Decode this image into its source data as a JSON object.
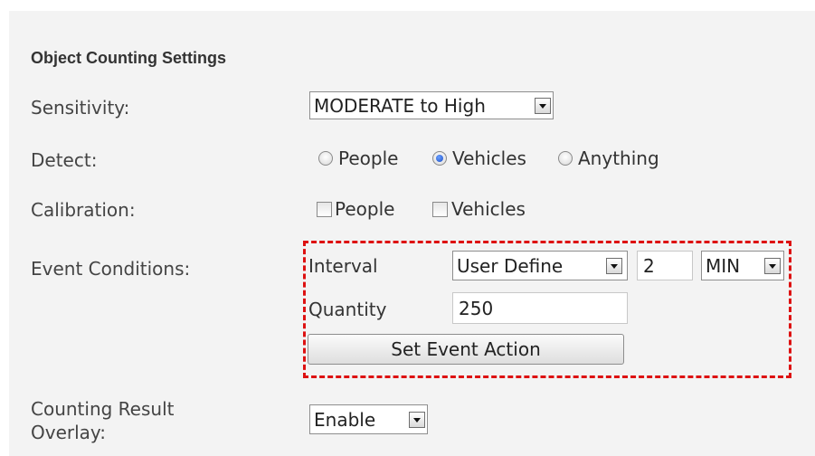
{
  "section_title": "Object Counting Settings",
  "sensitivity": {
    "label": "Sensitivity:",
    "value": "MODERATE to High"
  },
  "detect": {
    "label": "Detect:",
    "options": [
      {
        "label": "People",
        "checked": false
      },
      {
        "label": "Vehicles",
        "checked": true
      },
      {
        "label": "Anything",
        "checked": false
      }
    ]
  },
  "calibration": {
    "label": "Calibration:",
    "options": [
      {
        "label": "People",
        "checked": false
      },
      {
        "label": "Vehicles",
        "checked": false
      }
    ]
  },
  "event_conditions": {
    "label": "Event Conditions:",
    "interval_label": "Interval",
    "interval_mode": "User Define",
    "interval_value": "2",
    "interval_unit": "MIN",
    "quantity_label": "Quantity",
    "quantity_value": "250",
    "action_button": "Set Event Action"
  },
  "overlay": {
    "label_line1": "Counting Result",
    "label_line2": "Overlay:",
    "value": "Enable"
  },
  "colors": {
    "highlight_border": "#dd1111",
    "radio_checked": "#1d4fc4",
    "panel_bg": "#f3f3f3"
  },
  "icons": {
    "dropdown": "chevron-down-icon"
  }
}
